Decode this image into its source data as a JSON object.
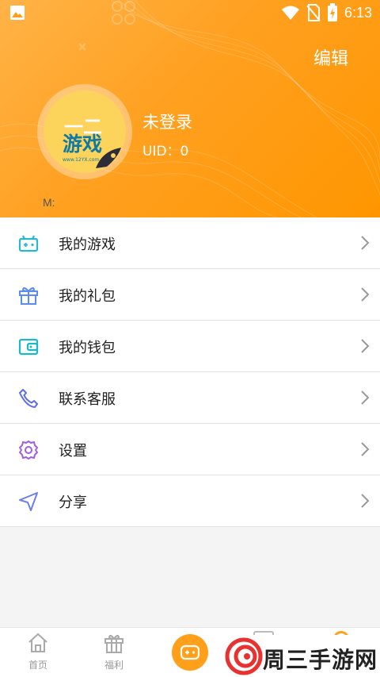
{
  "status_bar": {
    "time": "6:13"
  },
  "header": {
    "edit_label": "编辑"
  },
  "profile": {
    "username": "未登录",
    "uid_label": "UID：",
    "uid_value": "0",
    "m_label": "M:",
    "avatar_logo_top": "一二",
    "avatar_logo_main": "游戏",
    "avatar_logo_url": "www.12YX.com"
  },
  "menu": [
    {
      "label": "我的游戏",
      "icon": "gamepad-icon",
      "color": "#28b6d6"
    },
    {
      "label": "我的礼包",
      "icon": "gift-icon",
      "color": "#5b8def"
    },
    {
      "label": "我的钱包",
      "icon": "wallet-icon",
      "color": "#1eb7c9"
    },
    {
      "label": "联系客服",
      "icon": "phone-icon",
      "color": "#5b6ee8"
    },
    {
      "label": "设置",
      "icon": "gear-icon",
      "color": "#a25ee0"
    },
    {
      "label": "分享",
      "icon": "send-icon",
      "color": "#6d7fe8"
    }
  ],
  "bottom_nav": {
    "home_label": "首页",
    "welfare_label": "福利"
  },
  "watermark": {
    "text": "周三手游网"
  },
  "colors": {
    "accent": "#ff9f1a",
    "header_start": "#ffb347",
    "header_end": "#ff9600"
  }
}
